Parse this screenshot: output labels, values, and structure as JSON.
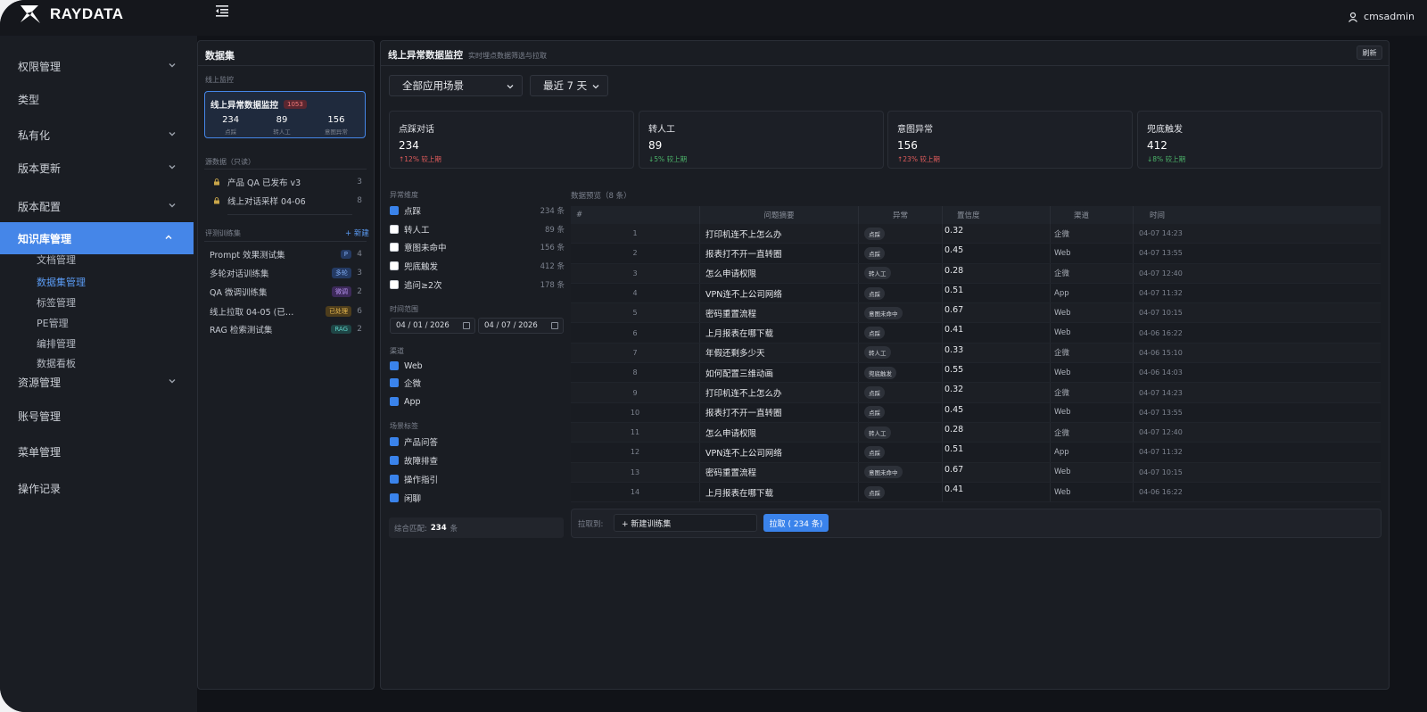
{
  "app": {
    "brand": "RAYDATA",
    "user": "cmsadmin"
  },
  "colors": {
    "accent": "#4586e8",
    "up": "#e25c5c",
    "down": "#4cb56a"
  },
  "sidebar": {
    "items": [
      {
        "label": "权限管理",
        "chevron": true
      },
      {
        "label": "类型",
        "chevron": false
      },
      {
        "label": "私有化",
        "chevron": true
      },
      {
        "label": "版本更新",
        "chevron": true
      },
      {
        "label": "版本配置",
        "chevron": true
      },
      {
        "label": "知识库管理",
        "chevron": true,
        "active": true
      },
      {
        "label": "资源管理",
        "chevron": true
      },
      {
        "label": "账号管理",
        "chevron": false
      },
      {
        "label": "菜单管理",
        "chevron": false
      },
      {
        "label": "操作记录",
        "chevron": false
      }
    ],
    "sub_items": [
      "文档管理",
      "数据集管理",
      "标签管理",
      "PE管理",
      "编排管理",
      "数据看板"
    ]
  },
  "datasets": {
    "title": "数据集",
    "online_label": "线上监控",
    "online_card": {
      "name": "线上异常数据监控",
      "badge": "1053",
      "stats": [
        {
          "value": "234",
          "label": "点踩"
        },
        {
          "value": "89",
          "label": "转人工"
        },
        {
          "value": "156",
          "label": "意图异常"
        }
      ]
    },
    "source_label": "源数据（只读）",
    "sources": [
      {
        "name": "产品 QA 已发布 v3",
        "count": "3"
      },
      {
        "name": "线上对话采样 04-06",
        "count": "8"
      }
    ],
    "eval_label": "评测训练集",
    "new_label": "+ 新建",
    "eval_sets": [
      {
        "name": "Prompt 效果测试集",
        "badge": "P",
        "count": "4"
      },
      {
        "name": "多轮对话训练集",
        "badge": "多轮",
        "count": "3"
      },
      {
        "name": "QA 微调训练集",
        "badge": "微调",
        "count": "2"
      },
      {
        "name": "线上拉取 04-05 (已…",
        "badge": "已处理",
        "count": "6"
      },
      {
        "name": "RAG 检索测试集",
        "badge": "RAG",
        "count": "2"
      }
    ]
  },
  "main": {
    "title": "线上异常数据监控",
    "subtitle": "实时埋点数据筛选与拉取",
    "refresh_label": "刷新",
    "scene_select": "全部应用场景",
    "range_select": "最近 7 天",
    "stat_cards": [
      {
        "label": "点踩对话",
        "value": "234",
        "trend": "↑12% 较上期",
        "direction": "up"
      },
      {
        "label": "转人工",
        "value": "89",
        "trend": "↓5% 较上期",
        "direction": "down"
      },
      {
        "label": "意图异常",
        "value": "156",
        "trend": "↑23% 较上期",
        "direction": "up"
      },
      {
        "label": "兜底触发",
        "value": "412",
        "trend": "↓8% 较上期",
        "direction": "down"
      }
    ],
    "filters": {
      "anomaly_title": "异常维度",
      "anomalies": [
        {
          "label": "点踩",
          "count": "234 条",
          "checked": true
        },
        {
          "label": "转人工",
          "count": "89 条",
          "checked": false
        },
        {
          "label": "意图未命中",
          "count": "156 条",
          "checked": false
        },
        {
          "label": "兜底触发",
          "count": "412 条",
          "checked": false
        },
        {
          "label": "追问≥2次",
          "count": "178 条",
          "checked": false
        }
      ],
      "time_title": "时间范围",
      "date_from": "04 / 01 / 2026",
      "date_to": "04 / 07 / 2026",
      "channel_title": "渠道",
      "channels": [
        "Web",
        "企微",
        "App"
      ],
      "scene_title": "场景标签",
      "scenes": [
        "产品问答",
        "故障排查",
        "操作指引",
        "闲聊"
      ],
      "match_prefix": "综合匹配:",
      "match_count": "234",
      "match_suffix": "条"
    },
    "preview_title": "数据预览（8 条）",
    "table": {
      "headers": [
        "#",
        "问题摘要",
        "异常",
        "置信度",
        "渠道",
        "时间"
      ],
      "rows": [
        [
          "1",
          "打印机连不上怎么办",
          "点踩",
          "0.32",
          "企微",
          "04-07 14:23"
        ],
        [
          "2",
          "报表打不开一直转圈",
          "点踩",
          "0.45",
          "Web",
          "04-07 13:55"
        ],
        [
          "3",
          "怎么申请权限",
          "转人工",
          "0.28",
          "企微",
          "04-07 12:40"
        ],
        [
          "4",
          "VPN连不上公司网络",
          "点踩",
          "0.51",
          "App",
          "04-07 11:32"
        ],
        [
          "5",
          "密码重置流程",
          "意图未命中",
          "0.67",
          "Web",
          "04-07 10:15"
        ],
        [
          "6",
          "上月报表在哪下载",
          "点踩",
          "0.41",
          "Web",
          "04-06 16:22"
        ],
        [
          "7",
          "年假还剩多少天",
          "转人工",
          "0.33",
          "企微",
          "04-06 15:10"
        ],
        [
          "8",
          "如何配置三维动画",
          "兜底触发",
          "0.55",
          "Web",
          "04-06 14:03"
        ],
        [
          "9",
          "打印机连不上怎么办",
          "点踩",
          "0.32",
          "企微",
          "04-07 14:23"
        ],
        [
          "10",
          "报表打不开一直转圈",
          "点踩",
          "0.45",
          "Web",
          "04-07 13:55"
        ],
        [
          "11",
          "怎么申请权限",
          "转人工",
          "0.28",
          "企微",
          "04-07 12:40"
        ],
        [
          "12",
          "VPN连不上公司网络",
          "点踩",
          "0.51",
          "App",
          "04-07 11:32"
        ],
        [
          "13",
          "密码重置流程",
          "意图未命中",
          "0.67",
          "Web",
          "04-07 10:15"
        ],
        [
          "14",
          "上月报表在哪下载",
          "点踩",
          "0.41",
          "Web",
          "04-06 16:22"
        ]
      ]
    },
    "pull": {
      "label": "拉取到:",
      "target": "+ 新建训练集",
      "button": "拉取 ( 234 条)"
    }
  }
}
